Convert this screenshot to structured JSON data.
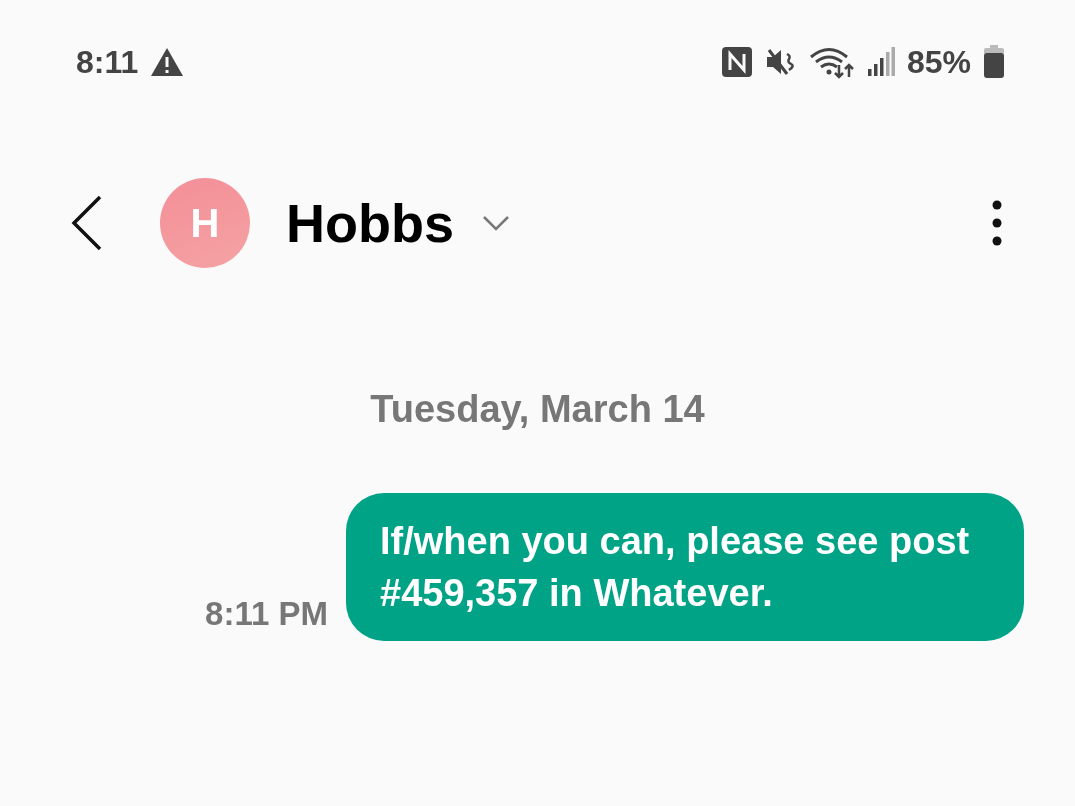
{
  "status_bar": {
    "time": "8:11",
    "battery": "85%"
  },
  "header": {
    "avatar_letter": "H",
    "name": "Hobbs"
  },
  "date_divider": "Tuesday, March 14",
  "messages": [
    {
      "kind": "sent",
      "text": "If/when you can, please see post #459,357 in Whatever.",
      "time": "8:11 PM"
    }
  ]
}
